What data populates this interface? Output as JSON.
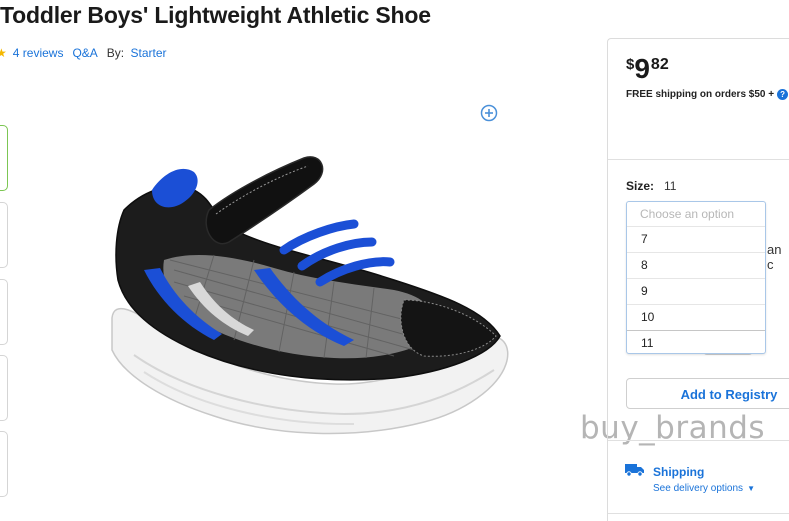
{
  "product": {
    "title": "Toddler Boys' Lightweight Athletic Shoe",
    "reviews_label": "4 reviews",
    "qa_label": "Q&A",
    "by_label": "By:",
    "brand": "Starter"
  },
  "price": {
    "currency": "$",
    "dollars": "9",
    "cents": "82",
    "shipping_note": "FREE shipping on orders $50 +"
  },
  "size": {
    "label": "Size:",
    "selected": "11",
    "placeholder": "Choose an option",
    "options": [
      "7",
      "8",
      "9",
      "10",
      "11"
    ]
  },
  "obscured_text": "an c",
  "registry_button": "Add to Registry",
  "shipping": {
    "title": "Shipping",
    "link": "See delivery options"
  },
  "watermark": "buy_brands",
  "colors": {
    "link": "#1a73d9",
    "accent_green": "#7cc653",
    "star": "#f5b800",
    "shoe_blue": "#1b4fd6",
    "shoe_black": "#1a1a1a"
  },
  "icons": [
    "star-icon",
    "zoom-plus-icon",
    "help-icon",
    "truck-icon",
    "caret-down-icon"
  ]
}
